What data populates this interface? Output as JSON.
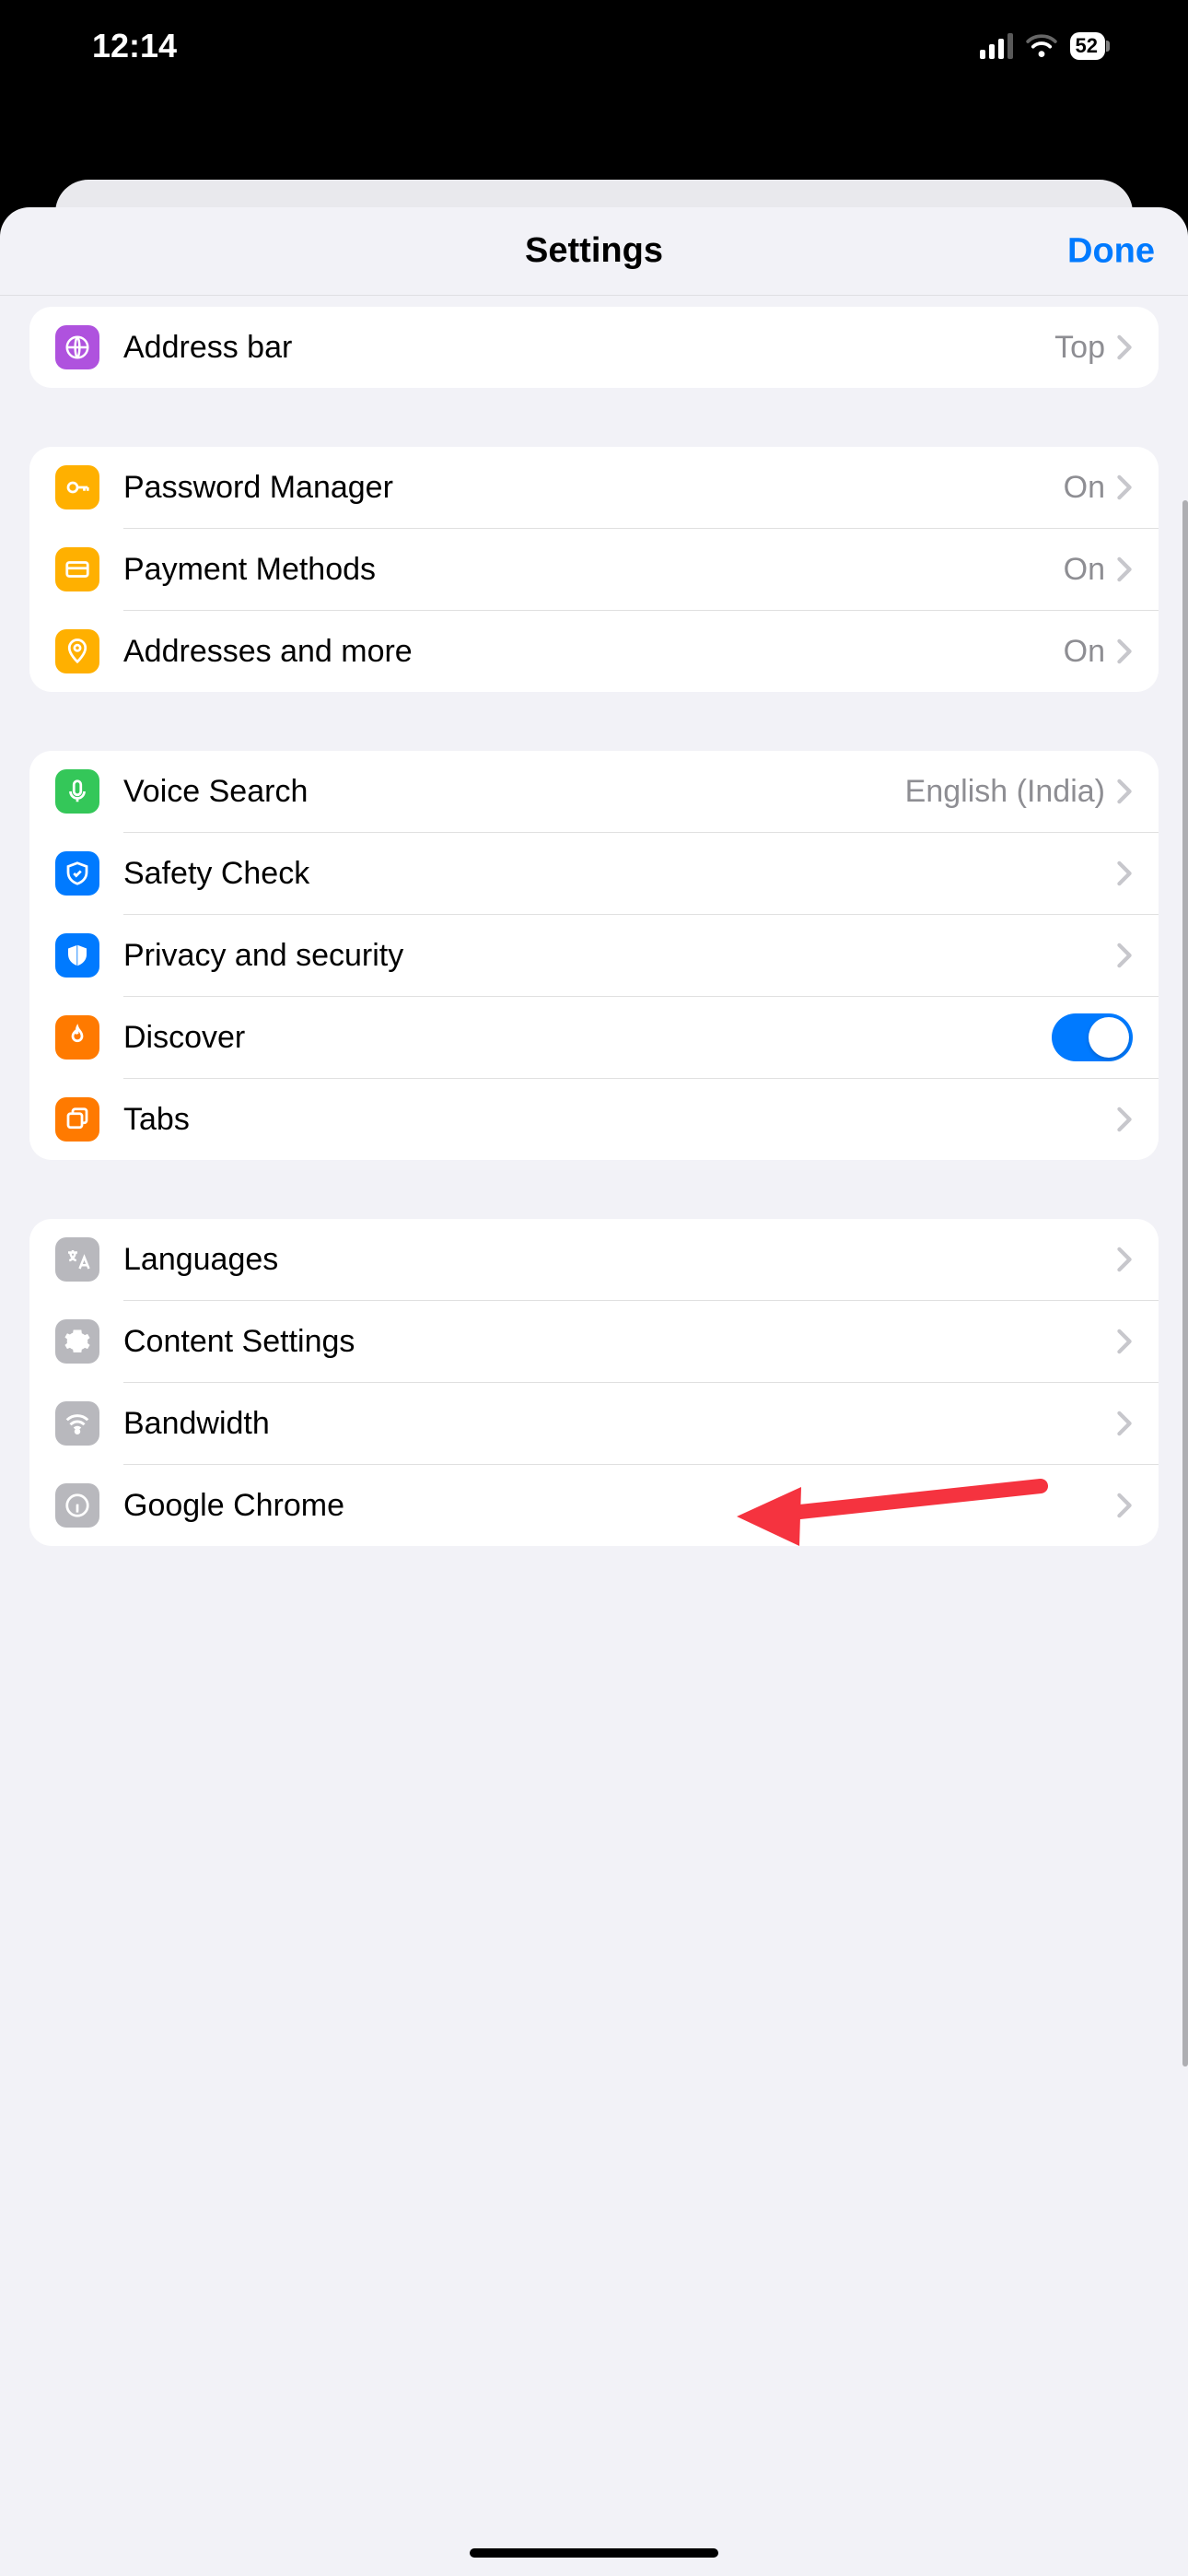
{
  "status": {
    "time": "12:14",
    "battery": "52"
  },
  "nav": {
    "title": "Settings",
    "done": "Done"
  },
  "groups": [
    {
      "rows": [
        {
          "key": "address_bar",
          "label": "Address bar",
          "value": "Top",
          "icon": "globe-icon",
          "iconBg": "purple",
          "hasChevron": true
        }
      ]
    },
    {
      "rows": [
        {
          "key": "password_manager",
          "label": "Password Manager",
          "value": "On",
          "icon": "key-icon",
          "iconBg": "amber",
          "hasChevron": true
        },
        {
          "key": "payment_methods",
          "label": "Payment Methods",
          "value": "On",
          "icon": "card-icon",
          "iconBg": "amber",
          "hasChevron": true
        },
        {
          "key": "addresses_more",
          "label": "Addresses and more",
          "value": "On",
          "icon": "pin-icon",
          "iconBg": "amber",
          "hasChevron": true
        }
      ]
    },
    {
      "rows": [
        {
          "key": "voice_search",
          "label": "Voice Search",
          "value": "English (India)",
          "icon": "mic-icon",
          "iconBg": "green",
          "hasChevron": true
        },
        {
          "key": "safety_check",
          "label": "Safety Check",
          "value": "",
          "icon": "shield-check-icon",
          "iconBg": "blue",
          "hasChevron": true
        },
        {
          "key": "privacy_security",
          "label": "Privacy and security",
          "value": "",
          "icon": "shield-icon",
          "iconBg": "blue",
          "hasChevron": true
        },
        {
          "key": "discover",
          "label": "Discover",
          "value": "",
          "icon": "flame-icon",
          "iconBg": "orange",
          "toggle": true,
          "toggleOn": true
        },
        {
          "key": "tabs",
          "label": "Tabs",
          "value": "",
          "icon": "tabs-icon",
          "iconBg": "orange",
          "hasChevron": true
        }
      ]
    },
    {
      "rows": [
        {
          "key": "languages",
          "label": "Languages",
          "value": "",
          "icon": "translate-icon",
          "iconBg": "gray",
          "hasChevron": true
        },
        {
          "key": "content_settings",
          "label": "Content Settings",
          "value": "",
          "icon": "gear-icon",
          "iconBg": "gray",
          "hasChevron": true
        },
        {
          "key": "bandwidth",
          "label": "Bandwidth",
          "value": "",
          "icon": "wifi-icon",
          "iconBg": "gray",
          "hasChevron": true
        },
        {
          "key": "google_chrome",
          "label": "Google Chrome",
          "value": "",
          "icon": "info-icon",
          "iconBg": "gray",
          "hasChevron": true
        }
      ]
    }
  ]
}
